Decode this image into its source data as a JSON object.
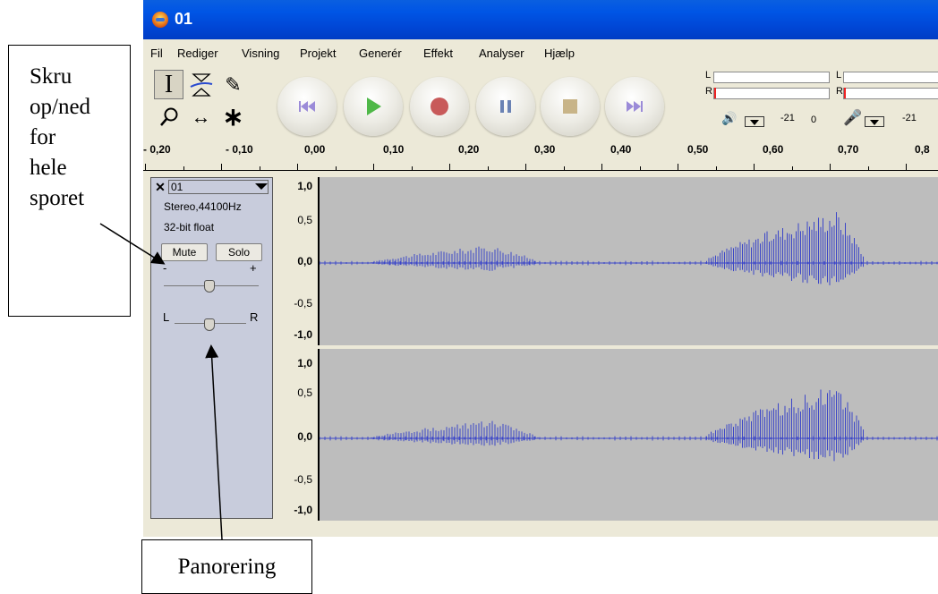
{
  "window": {
    "title": "01"
  },
  "menu": [
    "Fil",
    "Rediger",
    "Visning",
    "Projekt",
    "Generér",
    "Effekt",
    "Analyser",
    "Hjælp"
  ],
  "tools": [
    {
      "name": "select",
      "icon": "I-beam-icon",
      "label": "I"
    },
    {
      "name": "envelope",
      "icon": "envelope-icon"
    },
    {
      "name": "draw",
      "icon": "pencil-icon",
      "label": "✎"
    },
    {
      "name": "zoom",
      "icon": "magnifier-icon"
    },
    {
      "name": "timeshift",
      "icon": "double-arrow-icon",
      "label": "↔"
    },
    {
      "name": "multi",
      "icon": "asterisk-icon",
      "label": "∗"
    }
  ],
  "transport": [
    "skip-start-icon",
    "play-icon",
    "record-icon",
    "pause-icon",
    "stop-icon",
    "skip-end-icon"
  ],
  "meters": {
    "playback": {
      "channels": [
        "L",
        "R"
      ],
      "scale_left": "-21",
      "scale_right": "0"
    },
    "record": {
      "channels": [
        "L",
        "R"
      ],
      "scale_left": "-21"
    }
  },
  "ruler": {
    "ticks": [
      "- 0,20",
      "- 0,10",
      "0,00",
      "0,10",
      "0,20",
      "0,30",
      "0,40",
      "0,50",
      "0,60",
      "0,70",
      "0,8"
    ]
  },
  "track": {
    "name": "01",
    "format": "Stereo,44100Hz",
    "bit_depth": "32-bit float",
    "mute_label": "Mute",
    "solo_label": "Solo",
    "gain_minus": "-",
    "gain_plus": "+",
    "pan_left": "L",
    "pan_right": "R"
  },
  "scales": {
    "top": [
      "1,0",
      "0,5",
      "0,0",
      "-0,5",
      "-1,0"
    ],
    "bottom": [
      "1,0",
      "0,5",
      "0,0",
      "-0,5",
      "-1,0"
    ]
  },
  "annotations": {
    "left_lines": [
      "Skru",
      "op/ned",
      "for",
      "hele",
      "sporet"
    ],
    "bottom": "Panorering"
  },
  "colors": {
    "titlebar": "#0055e5",
    "waveform": "#3c46c8",
    "wave_bg": "#bdbdbd",
    "track_panel": "#c8ccdc"
  }
}
